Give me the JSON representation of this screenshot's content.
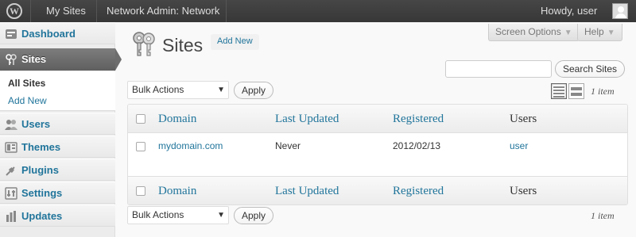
{
  "adminbar": {
    "my_sites": "My Sites",
    "network_admin": "Network Admin: Network",
    "howdy": "Howdy, user"
  },
  "sidebar": {
    "items": [
      {
        "label": "Dashboard",
        "icon": "dashboard-icon"
      },
      {
        "label": "Sites",
        "icon": "sites-icon",
        "current": true
      },
      {
        "label": "Users",
        "icon": "users-icon"
      },
      {
        "label": "Themes",
        "icon": "themes-icon"
      },
      {
        "label": "Plugins",
        "icon": "plugins-icon"
      },
      {
        "label": "Settings",
        "icon": "settings-icon"
      },
      {
        "label": "Updates",
        "icon": "updates-icon"
      }
    ],
    "submenu": [
      {
        "label": "All Sites",
        "current": true
      },
      {
        "label": "Add New"
      }
    ]
  },
  "header": {
    "screen_options": "Screen Options",
    "help": "Help",
    "title": "Sites",
    "add_new": "Add New",
    "search_button": "Search Sites",
    "search_value": ""
  },
  "bulk": {
    "selected": "Bulk Actions",
    "apply": "Apply",
    "count": "1 item"
  },
  "table": {
    "columns": [
      "Domain",
      "Last Updated",
      "Registered",
      "Users"
    ],
    "rows": [
      {
        "domain": "mydomain.com",
        "last_updated": "Never",
        "registered": "2012/02/13",
        "users": "user"
      }
    ]
  },
  "colors": {
    "link": "#21759b",
    "adminbar": "#464646",
    "menu_current": "#6d6d6d"
  }
}
